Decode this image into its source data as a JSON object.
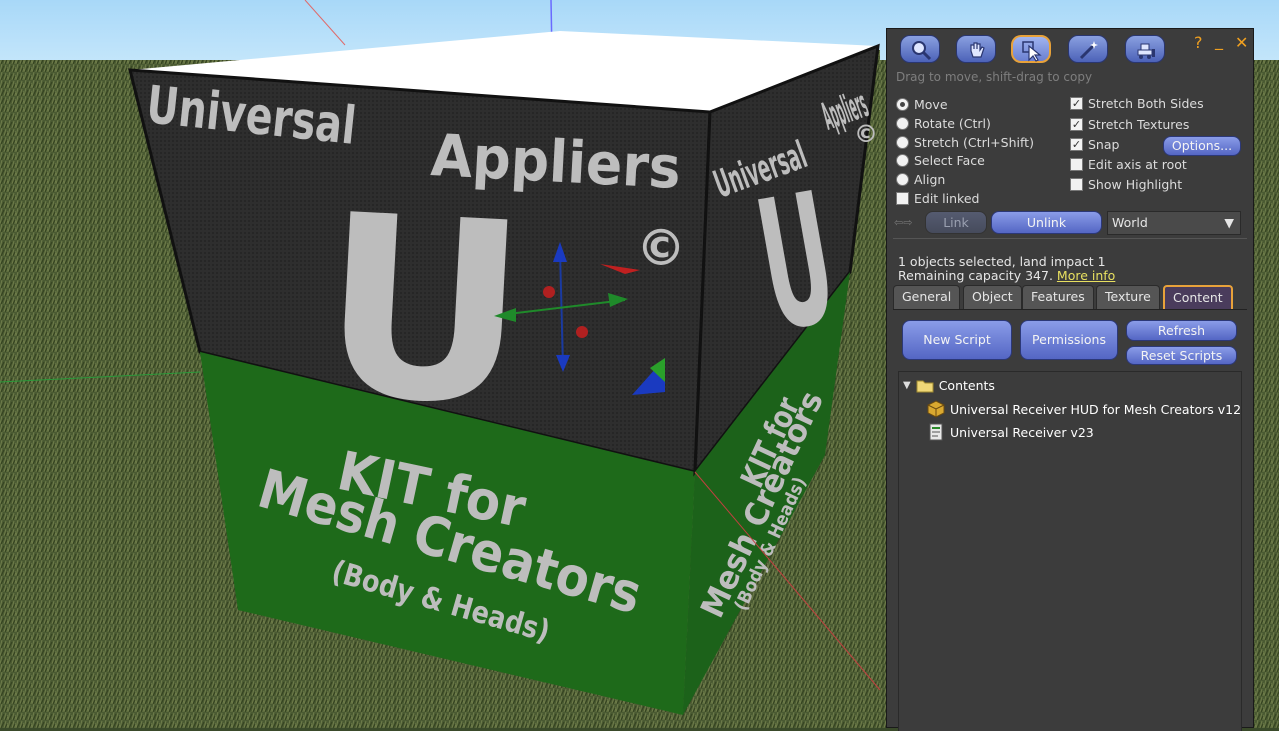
{
  "toolbar": {
    "tools": [
      {
        "name": "focus-tool-button",
        "icon": "magnifier-icon"
      },
      {
        "name": "move-tool-button",
        "icon": "grab-hand-icon"
      },
      {
        "name": "edit-tool-button",
        "icon": "select-arrow-icon",
        "active": true
      },
      {
        "name": "create-tool-button",
        "icon": "magic-wand-icon"
      },
      {
        "name": "land-tool-button",
        "icon": "bulldozer-icon"
      }
    ],
    "help_label": "?",
    "minimize_label": "_",
    "close_label": "✕"
  },
  "hint": "Drag to move, shift-drag to copy",
  "edit_modes": [
    {
      "label": "Move",
      "selected": true
    },
    {
      "label": "Rotate (Ctrl)",
      "selected": false
    },
    {
      "label": "Stretch (Ctrl+Shift)",
      "selected": false
    },
    {
      "label": "Select Face",
      "selected": false
    },
    {
      "label": "Align",
      "selected": false
    }
  ],
  "edit_linked": {
    "label": "Edit linked",
    "checked": false
  },
  "options": [
    {
      "label": "Stretch Both Sides",
      "checked": true
    },
    {
      "label": "Stretch Textures",
      "checked": true
    },
    {
      "label": "Snap",
      "checked": true
    },
    {
      "label": "Edit axis at root",
      "checked": false
    },
    {
      "label": "Show Highlight",
      "checked": false
    }
  ],
  "options_button": "Options...",
  "link_button": "Link",
  "unlink_button": "Unlink",
  "ruler_select": "World",
  "status": {
    "line1": "1 objects selected, land impact 1",
    "line2_prefix": "Remaining capacity 347.",
    "more_info": "More info"
  },
  "tabs": [
    {
      "label": "General"
    },
    {
      "label": "Object"
    },
    {
      "label": "Features"
    },
    {
      "label": "Texture"
    },
    {
      "label": "Content",
      "active": true
    }
  ],
  "content": {
    "new_script": "New Script",
    "permissions": "Permissions",
    "refresh": "Refresh",
    "reset_scripts": "Reset Scripts",
    "folder": "Contents",
    "items": [
      {
        "label": "Universal Receiver HUD for Mesh Creators v12",
        "icon": "object-box-icon"
      },
      {
        "label": "Universal Receiver v23",
        "icon": "script-icon"
      }
    ]
  },
  "scene": {
    "top_left_text": "Universal",
    "top_right_text": "Appliers",
    "big_letter": "U",
    "copyright": "©",
    "kit_line1": "KIT for",
    "kit_line2": "Mesh Creators",
    "kit_line3": "(Body & Heads)"
  },
  "colors": {
    "accent_orange": "#e8a23a",
    "button_blue": "#6a7cd6",
    "cube_green": "#1e6a1a",
    "cube_dark": "#2b2b2b",
    "link_yellow": "#e8e060"
  }
}
